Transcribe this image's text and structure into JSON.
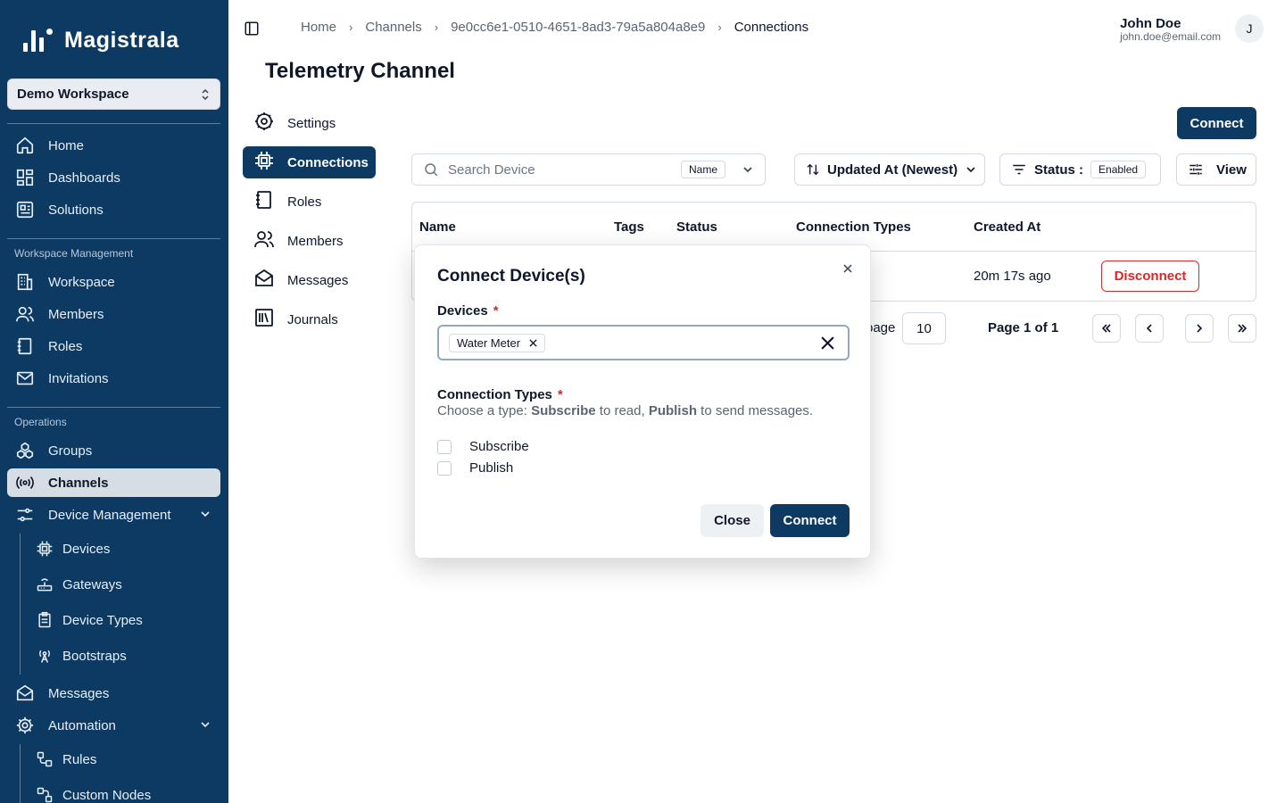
{
  "app": {
    "name": "Magistrala"
  },
  "sidebar": {
    "workspace": "Demo Workspace",
    "top_items": [
      {
        "label": "Home",
        "icon": "home-icon"
      },
      {
        "label": "Dashboards",
        "icon": "dashboard-icon"
      },
      {
        "label": "Solutions",
        "icon": "solutions-icon"
      }
    ],
    "workspace_section": "Workspace Management",
    "workspace_items": [
      {
        "label": "Workspace",
        "icon": "building-icon"
      },
      {
        "label": "Members",
        "icon": "users-icon"
      },
      {
        "label": "Roles",
        "icon": "notebook-icon"
      },
      {
        "label": "Invitations",
        "icon": "mail-icon"
      }
    ],
    "operations_section": "Operations",
    "operations_items": [
      {
        "label": "Groups",
        "icon": "groups-icon"
      },
      {
        "label": "Channels",
        "icon": "broadcast-icon"
      },
      {
        "label": "Device Management",
        "icon": "sliders-icon"
      }
    ],
    "device_sub_items": [
      {
        "label": "Devices",
        "icon": "cpu-icon"
      },
      {
        "label": "Gateways",
        "icon": "router-icon"
      },
      {
        "label": "Device Types",
        "icon": "clipboard-icon"
      },
      {
        "label": "Bootstraps",
        "icon": "radio-tower-icon"
      }
    ],
    "messages": "Messages",
    "automation": "Automation",
    "automation_sub_items": [
      {
        "label": "Rules",
        "icon": "workflow-icon"
      },
      {
        "label": "Custom Nodes",
        "icon": "nodes-icon"
      }
    ]
  },
  "header": {
    "breadcrumb": [
      "Home",
      "Channels",
      "9e0cc6e1-0510-4651-8ad3-79a5a804a8e9",
      "Connections"
    ],
    "user_name": "John Doe",
    "user_email": "john.doe@email.com",
    "avatar_initial": "J"
  },
  "page": {
    "title": "Telemetry Channel",
    "subnav": [
      "Settings",
      "Connections",
      "Roles",
      "Members",
      "Messages",
      "Journals"
    ],
    "connect_button": "Connect",
    "search_placeholder": "Search Device",
    "search_field": "Name",
    "sort_label": "Updated At (Newest)",
    "status_label": "Status :",
    "status_value": "Enabled",
    "view_label": "View"
  },
  "table": {
    "columns": [
      "Name",
      "Tags",
      "Status",
      "Connection Types",
      "Created At"
    ],
    "rows": [
      {
        "created_at": "20m 17s ago",
        "action": "Disconnect"
      }
    ],
    "rows_per_page_text": "page",
    "page_size": "10",
    "page_info": "Page 1 of 1"
  },
  "modal": {
    "title": "Connect Device(s)",
    "devices_label": "Devices",
    "required_mark": "*",
    "selected_device": "Water Meter",
    "connection_types_label": "Connection Types",
    "helper_prefix": "Choose a type: ",
    "helper_subscribe": "Subscribe",
    "helper_mid": " to read, ",
    "helper_publish": "Publish",
    "helper_suffix": " to send messages.",
    "options": [
      "Subscribe",
      "Publish"
    ],
    "close_button": "Close",
    "connect_button": "Connect"
  },
  "colors": {
    "sidebar_bg": "#0c3a63",
    "primary": "#0c3a63",
    "danger": "#dc2626"
  }
}
